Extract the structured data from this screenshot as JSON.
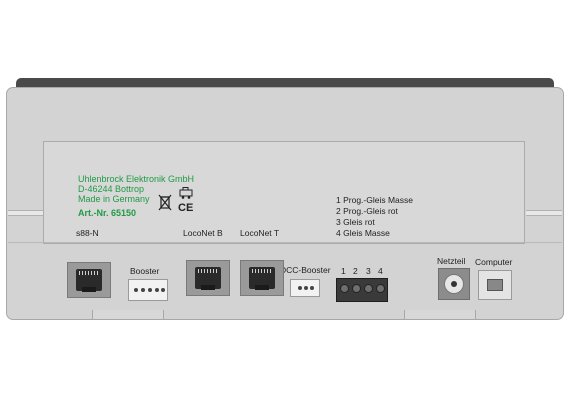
{
  "manufacturer": {
    "company": "Uhlenbrock Elektronik GmbH",
    "address": "D-46244 Bottrop",
    "origin": "Made in Germany",
    "article_number": "Art.-Nr. 65150"
  },
  "certification_icons": [
    "weee-crossed-bin-icon",
    "ce-mark-icon"
  ],
  "ce_text": "CE",
  "port_labels": {
    "s88": "s88-N",
    "booster": "Booster",
    "loconet_b": "LocoNet B",
    "loconet_t": "LocoNet T",
    "dcc_booster": "DCC-Booster",
    "power": "Netzteil",
    "computer": "Computer"
  },
  "terminal_numbers": [
    "1",
    "2",
    "3",
    "4"
  ],
  "terminal_legend": [
    "1  Prog.-Gleis Masse",
    "2  Prog.-Gleis rot",
    "3  Gleis rot",
    "4  Gleis Masse"
  ],
  "colors": {
    "text_green": "#1f9b45",
    "housing": "#d3d3d3",
    "top_bar": "#4a4a4a"
  }
}
